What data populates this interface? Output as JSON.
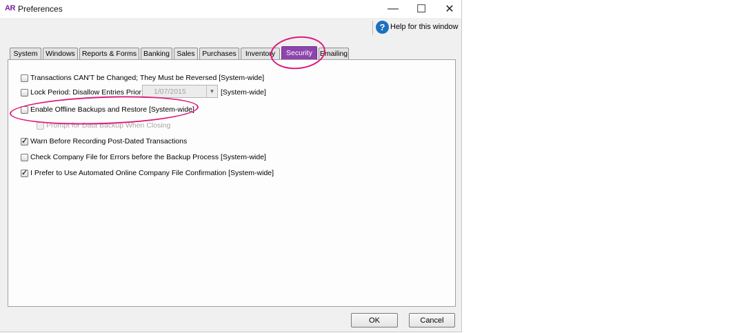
{
  "window": {
    "app_logo": "AR",
    "title": "Preferences",
    "minimize_glyph": "—",
    "maximize_glyph": "☐",
    "close_glyph": "✕"
  },
  "help": {
    "icon": "question-mark-icon",
    "icon_glyph": "?",
    "label": "Help for this window"
  },
  "tabs": [
    {
      "label": "System"
    },
    {
      "label": "Windows"
    },
    {
      "label": "Reports & Forms"
    },
    {
      "label": "Banking"
    },
    {
      "label": "Sales"
    },
    {
      "label": "Purchases"
    },
    {
      "label": "Inventory"
    },
    {
      "label": "Security",
      "active": true
    },
    {
      "label": "Emailing"
    }
  ],
  "options": [
    {
      "label": "Transactions CAN'T be Changed; They Must be Reversed [System-wide]",
      "checked": false,
      "enabled": true
    },
    {
      "label": "Lock Period: Disallow Entries Prior To:",
      "checked": false,
      "enabled": true
    },
    {
      "label": "Enable Offline Backups and Restore [System-wide]",
      "checked": false,
      "enabled": true
    },
    {
      "label": "Prompt for Data Backup When Closing",
      "checked": false,
      "enabled": false
    },
    {
      "label": "Warn Before Recording Post-Dated Transactions",
      "checked": true,
      "enabled": true
    },
    {
      "label": "Check Company File for Errors before the Backup Process [System-wide]",
      "checked": false,
      "enabled": true
    },
    {
      "label": "I Prefer to Use Automated Online Company File Confirmation [System-wide]",
      "checked": true,
      "enabled": true
    }
  ],
  "lock_period": {
    "date_value": "1/07/2015",
    "scope_suffix": "[System-wide]"
  },
  "buttons": {
    "ok": "OK",
    "cancel": "Cancel"
  },
  "colors": {
    "active_tab": "#8e44ad",
    "annotation": "#e0187a",
    "help_icon": "#1e6fc0"
  }
}
